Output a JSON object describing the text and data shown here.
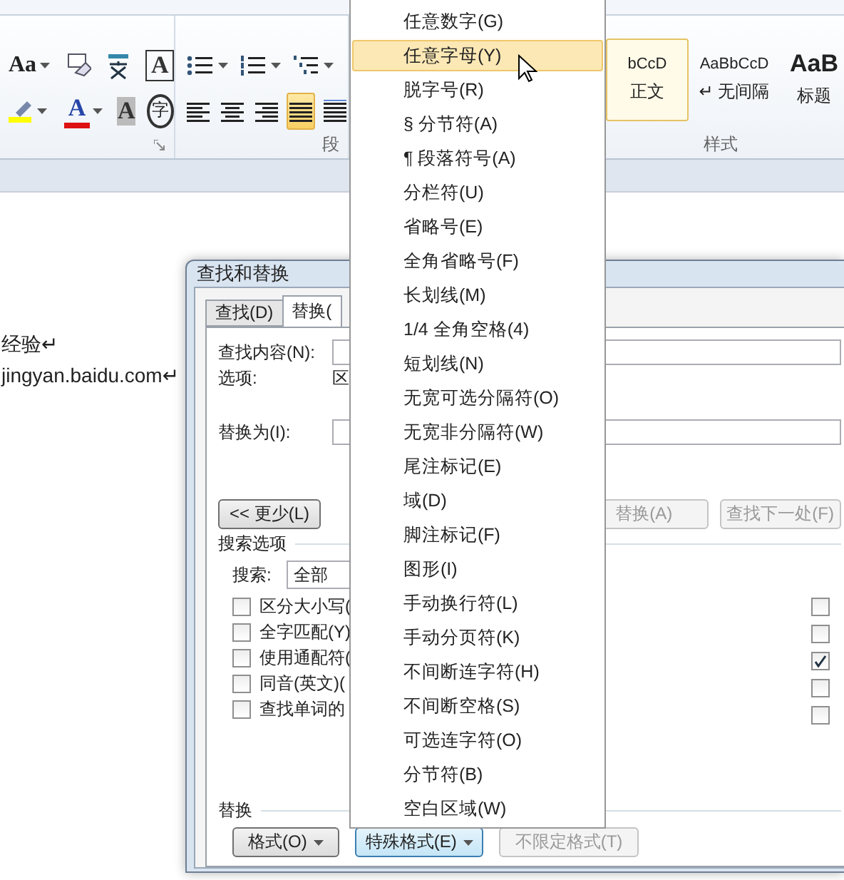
{
  "ribbon": {
    "font_group": {
      "change_case": "Aa",
      "border_char": "A",
      "font_color_char": "A",
      "shading_char": "A",
      "enclose_char": "字"
    },
    "paragraph_group": {
      "label": "段",
      "lists": [
        {
          "kind": "bullets"
        },
        {
          "kind": "numbered"
        },
        {
          "kind": "multilevel"
        }
      ],
      "alignment": [
        {
          "kind": "left",
          "selected": false
        },
        {
          "kind": "center",
          "selected": false
        },
        {
          "kind": "right",
          "selected": false
        },
        {
          "kind": "justify",
          "selected": true
        },
        {
          "kind": "distributed",
          "selected": false
        }
      ]
    },
    "styles_group": {
      "label": "样式",
      "styles": [
        {
          "preview": "bCcD",
          "label": "正文",
          "selected": true,
          "kind": "normal"
        },
        {
          "preview": "AaBbCcD",
          "label": "↵ 无间隔",
          "selected": false,
          "kind": "normal"
        },
        {
          "preview": "AaB",
          "label": "标题",
          "selected": false,
          "kind": "heading"
        }
      ]
    }
  },
  "document": {
    "lines": [
      "经验↵",
      "jingyan.baidu.com↵"
    ]
  },
  "dialog": {
    "title": "查找和替换",
    "tabs": [
      {
        "label": "查找(D)",
        "selected": false
      },
      {
        "label": "替换(",
        "selected": true
      }
    ],
    "find_label": "查找内容(N):",
    "options_label": "选项:",
    "options_value": "区",
    "replace_label": "替换为(I):",
    "less_button": "<< 更少(L)",
    "replace_all_button": "替换(A)",
    "find_next_button": "查找下一处(F)",
    "search_options_title": "搜索选项",
    "search_label": "搜索:",
    "search_value": "全部",
    "left_options": [
      {
        "label": "区分大小写(",
        "checked": false
      },
      {
        "label": "全字匹配(Y)",
        "checked": false
      },
      {
        "label": "使用通配符(",
        "checked": false
      },
      {
        "label": "同音(英文)(",
        "checked": false
      },
      {
        "label": "查找单词的",
        "checked": false
      }
    ],
    "right_options": [
      {
        "checked": false
      },
      {
        "checked": false
      },
      {
        "checked": true
      },
      {
        "checked": false
      },
      {
        "checked": false
      }
    ],
    "replace_section_title": "替换",
    "format_button": "格式(O)",
    "special_button": "特殊格式(E)",
    "no_format_button": "不限定格式(T)"
  },
  "menu": {
    "items": [
      {
        "label": "任意数字(G)",
        "selected": false
      },
      {
        "label": "任意字母(Y)",
        "selected": true
      },
      {
        "label": "脱字号(R)",
        "selected": false
      },
      {
        "label": "§ 分节符(A)",
        "selected": false
      },
      {
        "label": "¶ 段落符号(A)",
        "selected": false
      },
      {
        "label": "分栏符(U)",
        "selected": false
      },
      {
        "label": "省略号(E)",
        "selected": false
      },
      {
        "label": "全角省略号(F)",
        "selected": false
      },
      {
        "label": "长划线(M)",
        "selected": false
      },
      {
        "label": "1/4 全角空格(4)",
        "selected": false
      },
      {
        "label": "短划线(N)",
        "selected": false
      },
      {
        "label": "无宽可选分隔符(O)",
        "selected": false
      },
      {
        "label": "无宽非分隔符(W)",
        "selected": false
      },
      {
        "label": "尾注标记(E)",
        "selected": false
      },
      {
        "label": "域(D)",
        "selected": false
      },
      {
        "label": "脚注标记(F)",
        "selected": false
      },
      {
        "label": "图形(I)",
        "selected": false
      },
      {
        "label": "手动换行符(L)",
        "selected": false
      },
      {
        "label": "手动分页符(K)",
        "selected": false
      },
      {
        "label": "不间断连字符(H)",
        "selected": false
      },
      {
        "label": "不间断空格(S)",
        "selected": false
      },
      {
        "label": "可选连字符(O)",
        "selected": false
      },
      {
        "label": "分节符(B)",
        "selected": false
      },
      {
        "label": "空白区域(W)",
        "selected": false
      }
    ]
  }
}
